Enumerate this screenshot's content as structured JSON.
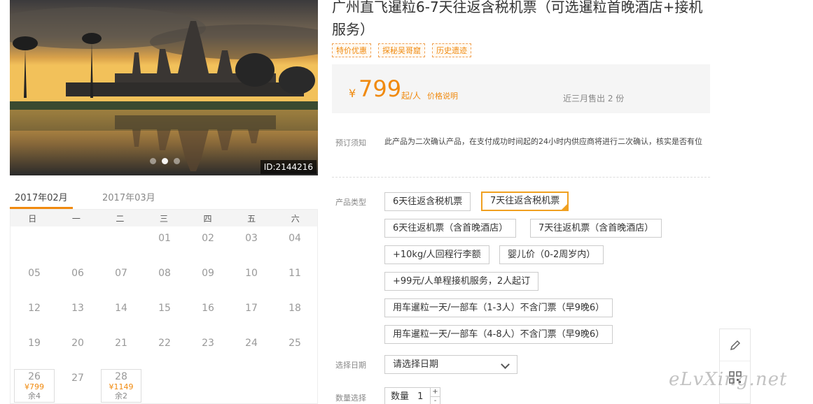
{
  "photo": {
    "id_label": "ID:2144216",
    "dots": [
      false,
      true,
      false
    ]
  },
  "calendar": {
    "tabs": [
      "2017年02月",
      "2017年03月"
    ],
    "weekdays": [
      "日",
      "一",
      "二",
      "三",
      "四",
      "五",
      "六"
    ],
    "cells": [
      {
        "d": ""
      },
      {
        "d": ""
      },
      {
        "d": ""
      },
      {
        "d": "01"
      },
      {
        "d": "02"
      },
      {
        "d": "03"
      },
      {
        "d": "04"
      },
      {
        "d": "05"
      },
      {
        "d": "06"
      },
      {
        "d": "07"
      },
      {
        "d": "08"
      },
      {
        "d": "09"
      },
      {
        "d": "10"
      },
      {
        "d": "11"
      },
      {
        "d": "12"
      },
      {
        "d": "13"
      },
      {
        "d": "14"
      },
      {
        "d": "15"
      },
      {
        "d": "16"
      },
      {
        "d": "17"
      },
      {
        "d": "18"
      },
      {
        "d": "19"
      },
      {
        "d": "20"
      },
      {
        "d": "21"
      },
      {
        "d": "22"
      },
      {
        "d": "23"
      },
      {
        "d": "24"
      },
      {
        "d": "25"
      },
      {
        "d": "26",
        "price": "¥799",
        "stock": "余4"
      },
      {
        "d": "27"
      },
      {
        "d": "28",
        "price": "¥1149",
        "stock": "余2"
      }
    ]
  },
  "product": {
    "title": "广州直飞暹粒6-7天往返含税机票（可选暹粒首晚酒店+接机服务）",
    "tags": [
      "特价优惠",
      "探秘吴哥窟",
      "历史遗迹"
    ],
    "price_currency": "¥",
    "price": "799",
    "price_unit": "起/人",
    "price_link": "价格说明",
    "sold": "近三月售出 2 份"
  },
  "notice": {
    "label": "预订须知",
    "text": "此产品为二次确认产品，在支付成功时间起的24小时内供应商将进行二次确认，核实是否有位"
  },
  "types": {
    "label": "产品类型",
    "options": [
      "6天往返含税机票",
      "7天往返含税机票",
      "6天往返机票（含首晚酒店）",
      "7天往返机票（含首晚酒店）",
      "+10kg/人回程行李额",
      "婴儿价（0-2周岁内）",
      "+99元/人单程接机服务，2人起订",
      "用车暹粒一天/一部车（1-3人）不含门票（早9晚6）",
      "用车暹粒一天/一部车（4-8人）不含门票（早9晚6）"
    ]
  },
  "date": {
    "label": "选择日期",
    "placeholder": "请选择日期"
  },
  "quantity": {
    "label": "数量选择",
    "prefix": "数量",
    "value": "1",
    "plus": "+",
    "minus": "-"
  },
  "watermark": "eLvXing.net"
}
